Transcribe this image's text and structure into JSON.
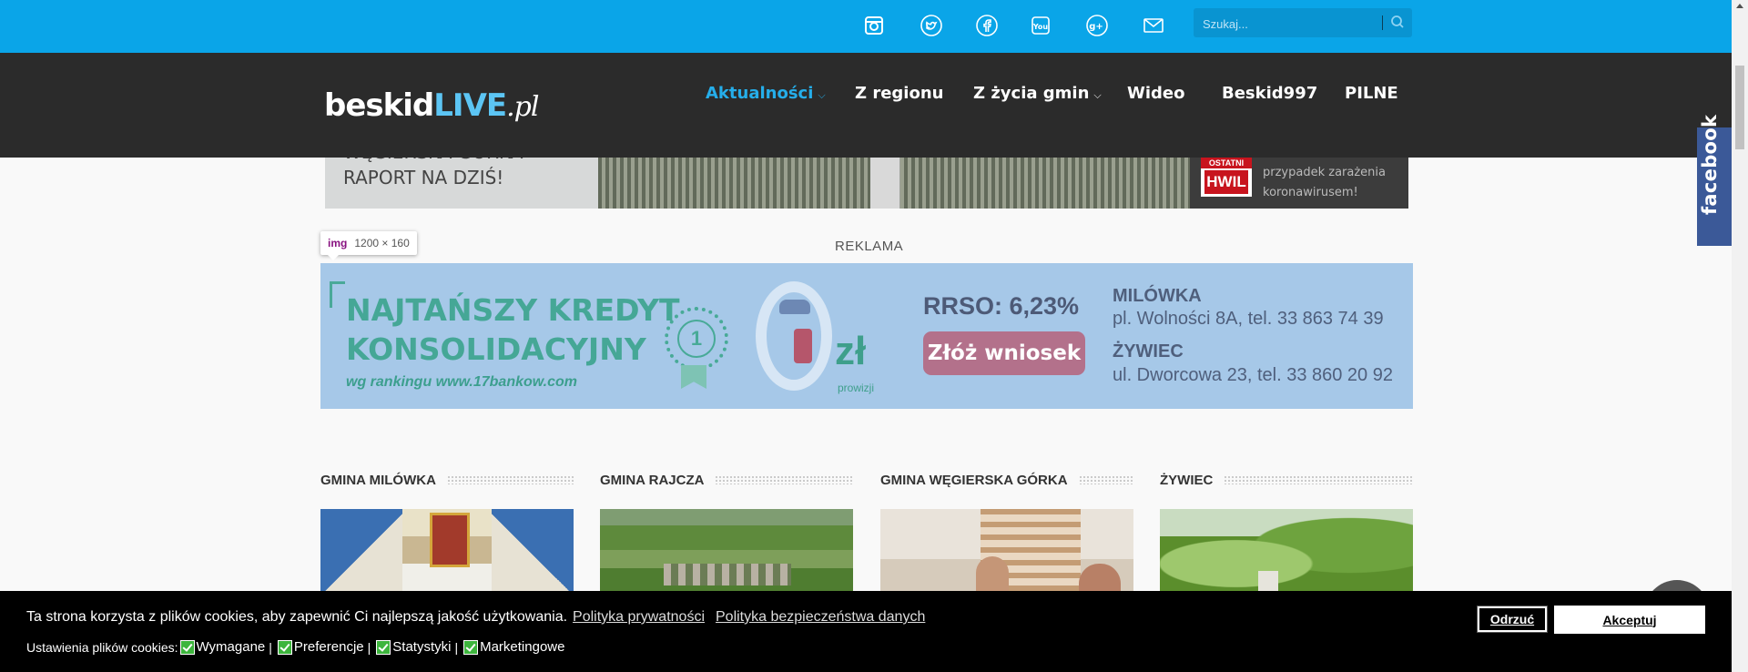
{
  "search": {
    "placeholder": "Szukaj..."
  },
  "social": [
    "instagram-icon",
    "twitter-icon",
    "facebook-icon",
    "youtube-icon",
    "google-plus-icon",
    "mail-icon"
  ],
  "logo": {
    "part1": "beskid",
    "part2": "LIVE",
    "part3": ".pl"
  },
  "nav": {
    "items": [
      {
        "label": "Aktualności",
        "dropdown": true,
        "active": true
      },
      {
        "label": "Z regionu",
        "dropdown": false
      },
      {
        "label": "Z życia gmin",
        "dropdown": true
      },
      {
        "label": "Wideo",
        "dropdown": false
      },
      {
        "label": "Beskid997",
        "dropdown": false
      },
      {
        "label": "PILNE",
        "dropdown": false
      }
    ],
    "chevron": "⌵"
  },
  "slider": {
    "title_line1": "WĘGIERSKA GÓRKA",
    "title_line2": "RAPORT NA DZIŚ!",
    "side_thumb_top": "OSTATNI",
    "side_thumb_main": "HWIL",
    "side_text_line1": "przypadek zarażenia",
    "side_text_line2": "koronawirusem!"
  },
  "tooltip": {
    "tag": "img",
    "dims": "1200 × 160"
  },
  "ad": {
    "label": "REKLAMA",
    "title_line1": "NAJTAŃSZY KREDYT",
    "title_line2": "KONSOLIDACYJNY",
    "rank": "wg rankingu  www.17bankow.com",
    "medal_number": "1",
    "zl": "zł",
    "prowizji": "prowizji",
    "rrso": "RRSO: 6,23%",
    "button": "Złóż wniosek",
    "city1": "MILÓWKA",
    "addr1": "pl. Wolności 8A, tel. 33 863 74 39",
    "city2": "ŻYWIEC",
    "addr2": "ul. Dworcowa 23, tel. 33 860 20 92"
  },
  "sections": [
    {
      "title": "GMINA MILÓWKA"
    },
    {
      "title": "GMINA RAJCZA"
    },
    {
      "title": "GMINA WĘGIERSKA GÓRKA"
    },
    {
      "title": "ŻYWIEC"
    }
  ],
  "facebook_tab": "facebook",
  "cookie": {
    "message": "Ta strona korzysta z plików cookies, aby zapewnić Ci najlepszą jakość użytkowania.",
    "link_privacy": "Polityka prywatności",
    "link_security": "Polityka bezpieczeństwa danych",
    "settings_label": "Ustawienia plików cookies:",
    "options": [
      "Wymagane",
      "Preferencje",
      "Statystyki",
      "Marketingowe"
    ],
    "refuse": "Odrzuć",
    "accept": "Akceptuj"
  },
  "colors": {
    "topbar": "#0aa5e8",
    "navbar": "#2b2b2b",
    "accent": "#25aeea",
    "facebook": "#3b5998",
    "ad_bg": "#a6c8e8"
  }
}
